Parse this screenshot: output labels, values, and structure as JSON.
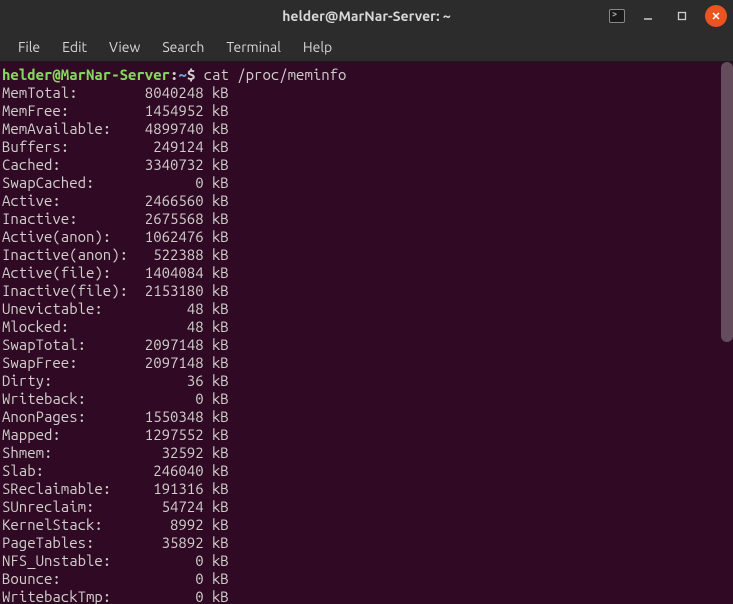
{
  "window": {
    "title": "helder@MarNar-Server: ~"
  },
  "menubar": {
    "items": [
      "File",
      "Edit",
      "View",
      "Search",
      "Terminal",
      "Help"
    ]
  },
  "prompt": {
    "user_host": "helder@MarNar-Server",
    "path": "~",
    "command": "cat /proc/meminfo"
  },
  "meminfo": [
    {
      "key": "MemTotal:",
      "value": "8040248",
      "unit": "kB"
    },
    {
      "key": "MemFree:",
      "value": "1454952",
      "unit": "kB"
    },
    {
      "key": "MemAvailable:",
      "value": "4899740",
      "unit": "kB"
    },
    {
      "key": "Buffers:",
      "value": "249124",
      "unit": "kB"
    },
    {
      "key": "Cached:",
      "value": "3340732",
      "unit": "kB"
    },
    {
      "key": "SwapCached:",
      "value": "0",
      "unit": "kB"
    },
    {
      "key": "Active:",
      "value": "2466560",
      "unit": "kB"
    },
    {
      "key": "Inactive:",
      "value": "2675568",
      "unit": "kB"
    },
    {
      "key": "Active(anon):",
      "value": "1062476",
      "unit": "kB"
    },
    {
      "key": "Inactive(anon):",
      "value": "522388",
      "unit": "kB"
    },
    {
      "key": "Active(file):",
      "value": "1404084",
      "unit": "kB"
    },
    {
      "key": "Inactive(file):",
      "value": "2153180",
      "unit": "kB"
    },
    {
      "key": "Unevictable:",
      "value": "48",
      "unit": "kB"
    },
    {
      "key": "Mlocked:",
      "value": "48",
      "unit": "kB"
    },
    {
      "key": "SwapTotal:",
      "value": "2097148",
      "unit": "kB"
    },
    {
      "key": "SwapFree:",
      "value": "2097148",
      "unit": "kB"
    },
    {
      "key": "Dirty:",
      "value": "36",
      "unit": "kB"
    },
    {
      "key": "Writeback:",
      "value": "0",
      "unit": "kB"
    },
    {
      "key": "AnonPages:",
      "value": "1550348",
      "unit": "kB"
    },
    {
      "key": "Mapped:",
      "value": "1297552",
      "unit": "kB"
    },
    {
      "key": "Shmem:",
      "value": "32592",
      "unit": "kB"
    },
    {
      "key": "Slab:",
      "value": "246040",
      "unit": "kB"
    },
    {
      "key": "SReclaimable:",
      "value": "191316",
      "unit": "kB"
    },
    {
      "key": "SUnreclaim:",
      "value": "54724",
      "unit": "kB"
    },
    {
      "key": "KernelStack:",
      "value": "8992",
      "unit": "kB"
    },
    {
      "key": "PageTables:",
      "value": "35892",
      "unit": "kB"
    },
    {
      "key": "NFS_Unstable:",
      "value": "0",
      "unit": "kB"
    },
    {
      "key": "Bounce:",
      "value": "0",
      "unit": "kB"
    },
    {
      "key": "WritebackTmp:",
      "value": "0",
      "unit": "kB"
    }
  ]
}
